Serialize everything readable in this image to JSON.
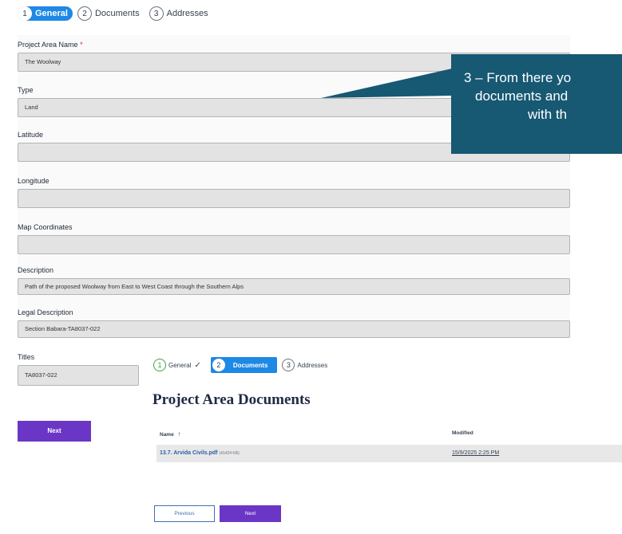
{
  "stepper_main": {
    "steps": [
      {
        "num": "1",
        "label": "General"
      },
      {
        "num": "2",
        "label": "Documents"
      },
      {
        "num": "3",
        "label": "Addresses"
      }
    ]
  },
  "form": {
    "project_area_name": {
      "label": "Project Area Name",
      "required": "*",
      "value": "The Woolway"
    },
    "type": {
      "label": "Type",
      "value": "Land"
    },
    "latitude": {
      "label": "Latitude",
      "value": ""
    },
    "longitude": {
      "label": "Longitude",
      "value": ""
    },
    "map_coordinates": {
      "label": "Map Coordinates",
      "value": ""
    },
    "description": {
      "label": "Description",
      "value": "Path of the proposed Woolway from East to West Coast through the Southern Alps"
    },
    "legal_description": {
      "label": "Legal Description",
      "value": "Section Babara-TA8037-022"
    },
    "titles": {
      "label": "Titles",
      "value": "TA8037-022"
    },
    "next_label": "Next"
  },
  "stepper_doc": {
    "steps": [
      {
        "num": "1",
        "label": "General",
        "check": "✓"
      },
      {
        "num": "2",
        "label": "Documents"
      },
      {
        "num": "3",
        "label": "Addresses"
      }
    ]
  },
  "documents": {
    "title": "Project Area Documents",
    "columns": {
      "name": "Name",
      "name_sort": "↑",
      "modified": "Modified"
    },
    "rows": [
      {
        "name": "13.7. Arvida Civils.pdf",
        "size": "(41424 KB)",
        "modified": "15/9/2025 2:25 PM"
      }
    ],
    "previous_label": "Previous",
    "next_label": "Next"
  },
  "callout": {
    "lines": [
      "3 – From there yo",
      "documents and",
      "with th"
    ]
  },
  "colors": {
    "accent_blue": "#1e88e5",
    "purple_button": "#6b36c6",
    "callout_bg": "#175873",
    "link": "#2b5fa8",
    "done_green": "#43a047"
  }
}
